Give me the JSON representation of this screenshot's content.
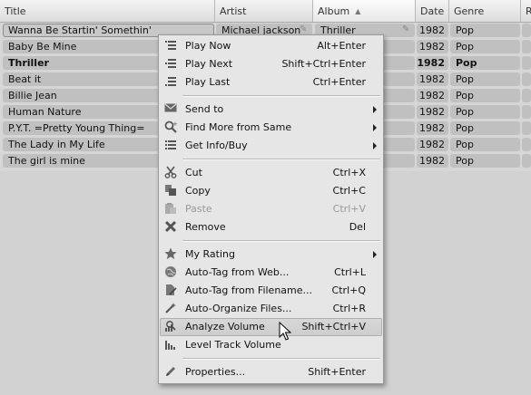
{
  "columns": [
    {
      "label": "Title"
    },
    {
      "label": "Artist"
    },
    {
      "label": "Album",
      "sorted": true
    },
    {
      "label": "Date"
    },
    {
      "label": "Genre"
    },
    {
      "label": "R"
    }
  ],
  "tracks": [
    {
      "title": "Wanna Be Startin' Somethin'",
      "artist": "Michael jackson",
      "album": "Thriller",
      "date": "1982",
      "genre": "Pop"
    },
    {
      "title": "Baby Be Mine",
      "artist": "",
      "album": "",
      "date": "1982",
      "genre": "Pop"
    },
    {
      "title": "Thriller",
      "artist": "",
      "album": "",
      "date": "1982",
      "genre": "Pop"
    },
    {
      "title": "Beat it",
      "artist": "",
      "album": "",
      "date": "1982",
      "genre": "Pop"
    },
    {
      "title": "Billie Jean",
      "artist": "",
      "album": "",
      "date": "1982",
      "genre": "Pop"
    },
    {
      "title": "Human Nature",
      "artist": "",
      "album": "",
      "date": "1982",
      "genre": "Pop"
    },
    {
      "title": "P.Y.T. =Pretty Young Thing=",
      "artist": "",
      "album": "",
      "date": "1982",
      "genre": "Pop"
    },
    {
      "title": "The Lady in My Life",
      "artist": "",
      "album": "",
      "date": "1982",
      "genre": "Pop"
    },
    {
      "title": "The girl is mine",
      "artist": "",
      "album": "",
      "date": "1982",
      "genre": "Pop"
    }
  ],
  "context_menu": {
    "items": [
      {
        "label": "Play Now",
        "shortcut": "Alt+Enter",
        "icon": "play-now-icon"
      },
      {
        "label": "Play Next",
        "shortcut": "Shift+Ctrl+Enter",
        "icon": "play-next-icon"
      },
      {
        "label": "Play Last",
        "shortcut": "Ctrl+Enter",
        "icon": "play-last-icon"
      },
      {
        "label": "Send to",
        "shortcut": "",
        "icon": "envelope-icon",
        "submenu": true
      },
      {
        "label": "Find More from Same",
        "shortcut": "",
        "icon": "find-icon",
        "submenu": true
      },
      {
        "label": "Get Info/Buy",
        "shortcut": "",
        "icon": "info-list-icon",
        "submenu": true
      },
      {
        "label": "Cut",
        "shortcut": "Ctrl+X",
        "icon": "scissors-icon"
      },
      {
        "label": "Copy",
        "shortcut": "Ctrl+C",
        "icon": "copy-icon"
      },
      {
        "label": "Paste",
        "shortcut": "Ctrl+V",
        "icon": "paste-icon",
        "disabled": true
      },
      {
        "label": "Remove",
        "shortcut": "Del",
        "icon": "remove-x-icon"
      },
      {
        "label": "My Rating",
        "shortcut": "",
        "icon": "star-icon",
        "submenu": true
      },
      {
        "label": "Auto-Tag from Web...",
        "shortcut": "Ctrl+L",
        "icon": "globe-tag-icon"
      },
      {
        "label": "Auto-Tag from Filename...",
        "shortcut": "Ctrl+Q",
        "icon": "file-tag-icon"
      },
      {
        "label": "Auto-Organize Files...",
        "shortcut": "Ctrl+R",
        "icon": "wand-icon"
      },
      {
        "label": "Analyze Volume",
        "shortcut": "Shift+Ctrl+V",
        "icon": "analyze-volume-icon",
        "highlighted": true
      },
      {
        "label": "Level Track Volume",
        "shortcut": "",
        "icon": "level-volume-icon"
      },
      {
        "label": "Properties...",
        "shortcut": "Shift+Enter",
        "icon": "pencil-icon"
      }
    ]
  },
  "colors": {
    "background": "#d6d6d6",
    "row_cell": "#c0c0c0",
    "menu_bg": "#e6e6e6",
    "highlight": "#cdcdcd"
  }
}
